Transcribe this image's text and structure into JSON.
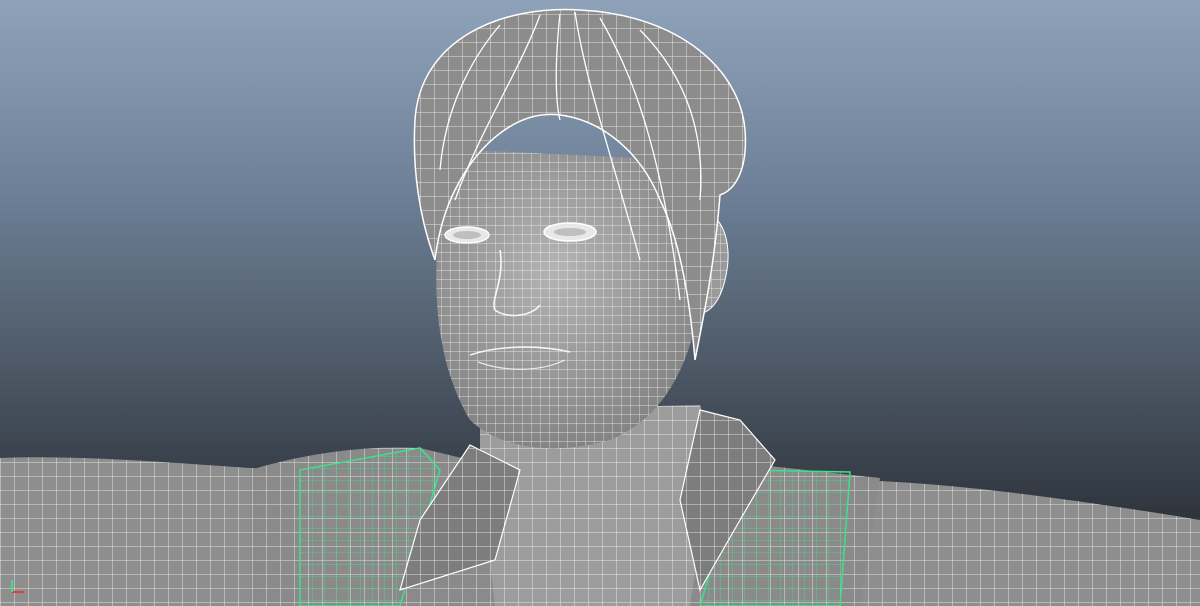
{
  "viewport": {
    "background_top": "#8ea2ba",
    "background_bottom": "#262b31",
    "wireframe_color": "#ffffff",
    "selection_color": "#3fe08a",
    "shaded_color": "#9a9a9a"
  },
  "gizmo": {
    "icon": "xyz-axis-icon",
    "x_color": "#e04040",
    "y_color": "#3fe08a"
  }
}
